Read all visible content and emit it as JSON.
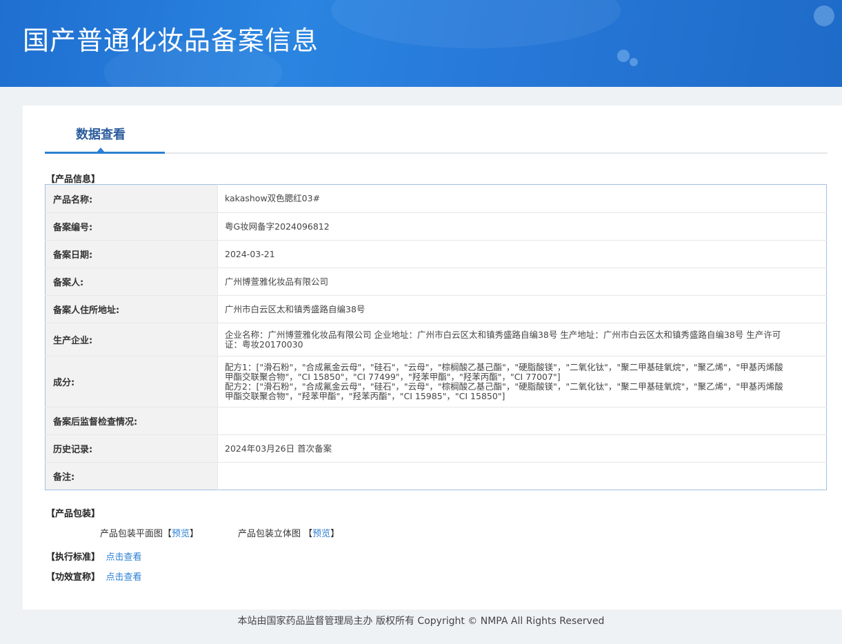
{
  "header": {
    "title": "国产普通化妆品备案信息"
  },
  "tabs": [
    {
      "label": "数据查看"
    }
  ],
  "product_info": {
    "section_label": "【产品信息】",
    "rows": [
      {
        "label": "产品名称:",
        "value": "kakashow双色腮红03#"
      },
      {
        "label": "备案编号:",
        "value": "粤G妆网备字2024096812"
      },
      {
        "label": "备案日期:",
        "value": "2024-03-21"
      },
      {
        "label": "备案人:",
        "value": "广州博萱雅化妆品有限公司"
      },
      {
        "label": "备案人住所地址:",
        "value": "广州市白云区太和镇秀盛路自编38号"
      },
      {
        "label": "生产企业:",
        "value": "企业名称：广州博萱雅化妆品有限公司 企业地址：广州市白云区太和镇秀盛路自编38号 生产地址：广州市白云区太和镇秀盛路自编38号 生产许可证：粤妆20170030"
      },
      {
        "label": "成分:",
        "value_lines": [
          "配方1：[\"滑石粉\"，\"合成氟金云母\"，\"硅石\"，\"云母\"，\"棕榈酸乙基己酯\"，\"硬脂酸镁\"，\"二氧化钛\"，\"聚二甲基硅氧烷\"，\"聚乙烯\"，\"甲基丙烯酸甲酯交联聚合物\"，\"CI 15850\"，\"CI 77499\"，\"羟苯甲酯\"，\"羟苯丙酯\"，\"CI 77007\"]",
          "配方2：[\"滑石粉\"，\"合成氟金云母\"，\"硅石\"，\"云母\"，\"棕榈酸乙基己酯\"，\"硬脂酸镁\"，\"二氧化钛\"，\"聚二甲基硅氧烷\"，\"聚乙烯\"，\"甲基丙烯酸甲酯交联聚合物\"，\"羟苯甲酯\"，\"羟苯丙酯\"，\"CI 15985\"，\"CI 15850\"]"
        ]
      },
      {
        "label": "备案后监督检查情况:",
        "value": ""
      },
      {
        "label": "历史记录:",
        "value": "2024年03月26日 首次备案"
      },
      {
        "label": "备注:",
        "value": ""
      }
    ]
  },
  "packaging": {
    "section_label": "【产品包装】",
    "flat_label": "产品包装平面图",
    "flat_link": "预览",
    "solid_label": "产品包装立体图",
    "solid_link": "预览"
  },
  "standard": {
    "label": "【执行标准】",
    "link": "点击查看"
  },
  "efficacy": {
    "label": "【功效宣称】",
    "link": "点击查看"
  },
  "footer": {
    "text": "本站由国家药品监督管理局主办 版权所有 Copyright © NMPA All Rights Reserved"
  },
  "colors": {
    "banner": "#2a84e0",
    "accent": "#2b7fd4",
    "tab_text": "#2a5b9c"
  }
}
